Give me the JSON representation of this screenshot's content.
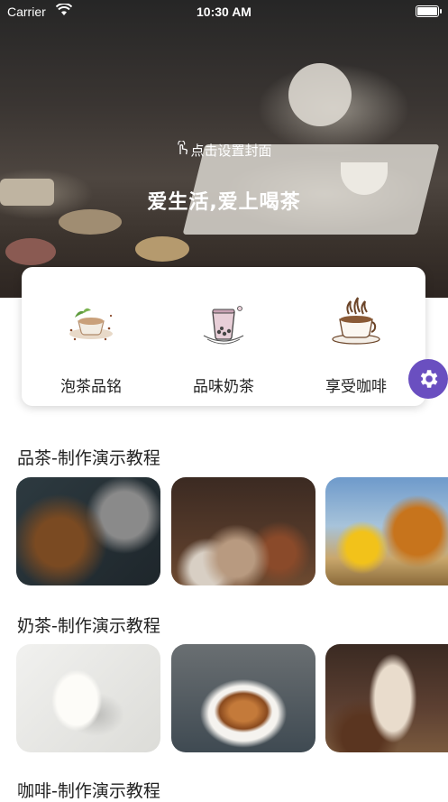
{
  "status_bar": {
    "carrier": "Carrier",
    "time": "10:30 AM"
  },
  "hero": {
    "set_cover_label": "点击设置封面",
    "slogan": "爱生活,爱上喝茶"
  },
  "categories": [
    {
      "label": "泡茶品铭",
      "icon": "tea-cup-icon"
    },
    {
      "label": "品味奶茶",
      "icon": "milk-tea-icon"
    },
    {
      "label": "享受咖啡",
      "icon": "coffee-cup-icon"
    }
  ],
  "floating_button": {
    "icon": "gear-icon",
    "color": "#6a4fc0"
  },
  "sections": [
    {
      "title": "品茶-制作演示教程",
      "thumbnails": [
        "loose-tea-leaves-photo",
        "pouring-tea-photo",
        "herbal-tea-flowers-photo"
      ]
    },
    {
      "title": "奶茶-制作演示教程",
      "thumbnails": [
        "glass-of-milk-photo",
        "latte-art-photo",
        "iced-milk-tea-photo"
      ]
    },
    {
      "title": "咖啡-制作演示教程"
    }
  ]
}
